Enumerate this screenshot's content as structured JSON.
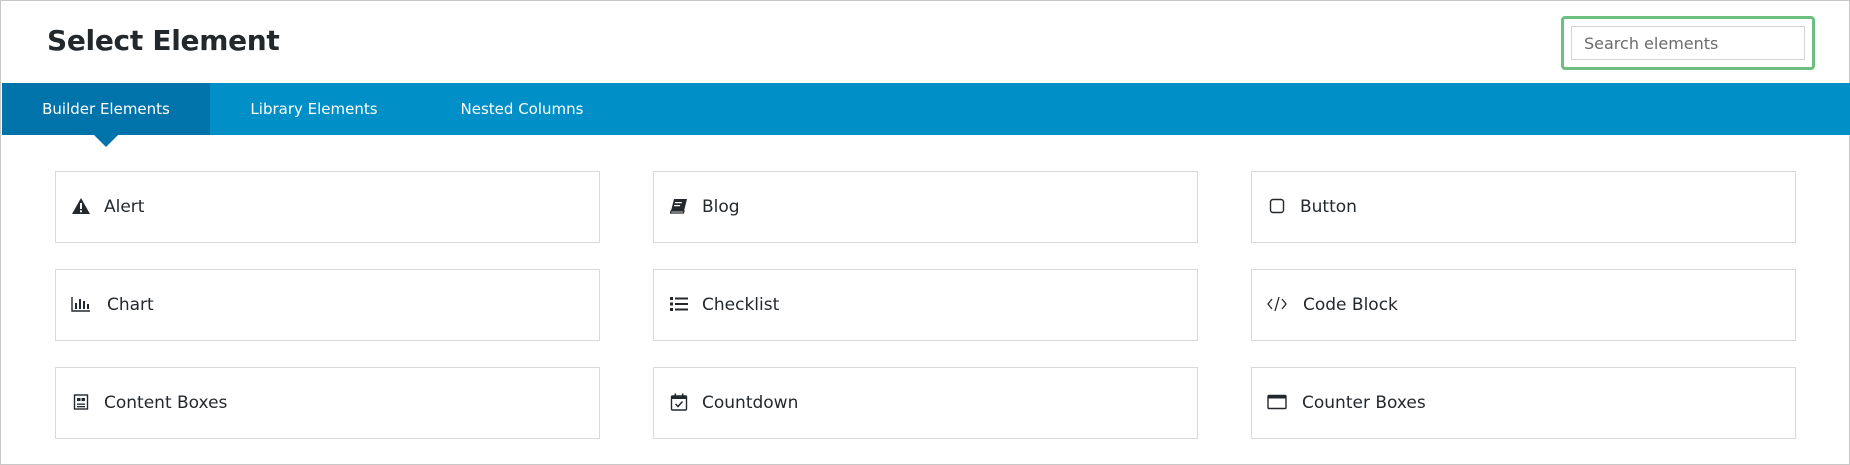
{
  "header": {
    "title": "Select Element"
  },
  "search": {
    "placeholder": "Search elements",
    "value": ""
  },
  "tabs": [
    {
      "label": "Builder Elements",
      "active": true
    },
    {
      "label": "Library Elements",
      "active": false
    },
    {
      "label": "Nested Columns",
      "active": false
    }
  ],
  "elements": [
    {
      "label": "Alert",
      "icon": "warning-icon"
    },
    {
      "label": "Blog",
      "icon": "book-icon"
    },
    {
      "label": "Button",
      "icon": "square-icon"
    },
    {
      "label": "Chart",
      "icon": "bar-chart-icon"
    },
    {
      "label": "Checklist",
      "icon": "list-icon"
    },
    {
      "label": "Code Block",
      "icon": "code-icon"
    },
    {
      "label": "Content Boxes",
      "icon": "content-boxes-icon"
    },
    {
      "label": "Countdown",
      "icon": "calendar-check-icon"
    },
    {
      "label": "Counter Boxes",
      "icon": "window-icon"
    }
  ],
  "colors": {
    "tab_bar": "#008fc6",
    "tab_active": "#0073aa",
    "search_focus_border": "#6cbf7f"
  }
}
